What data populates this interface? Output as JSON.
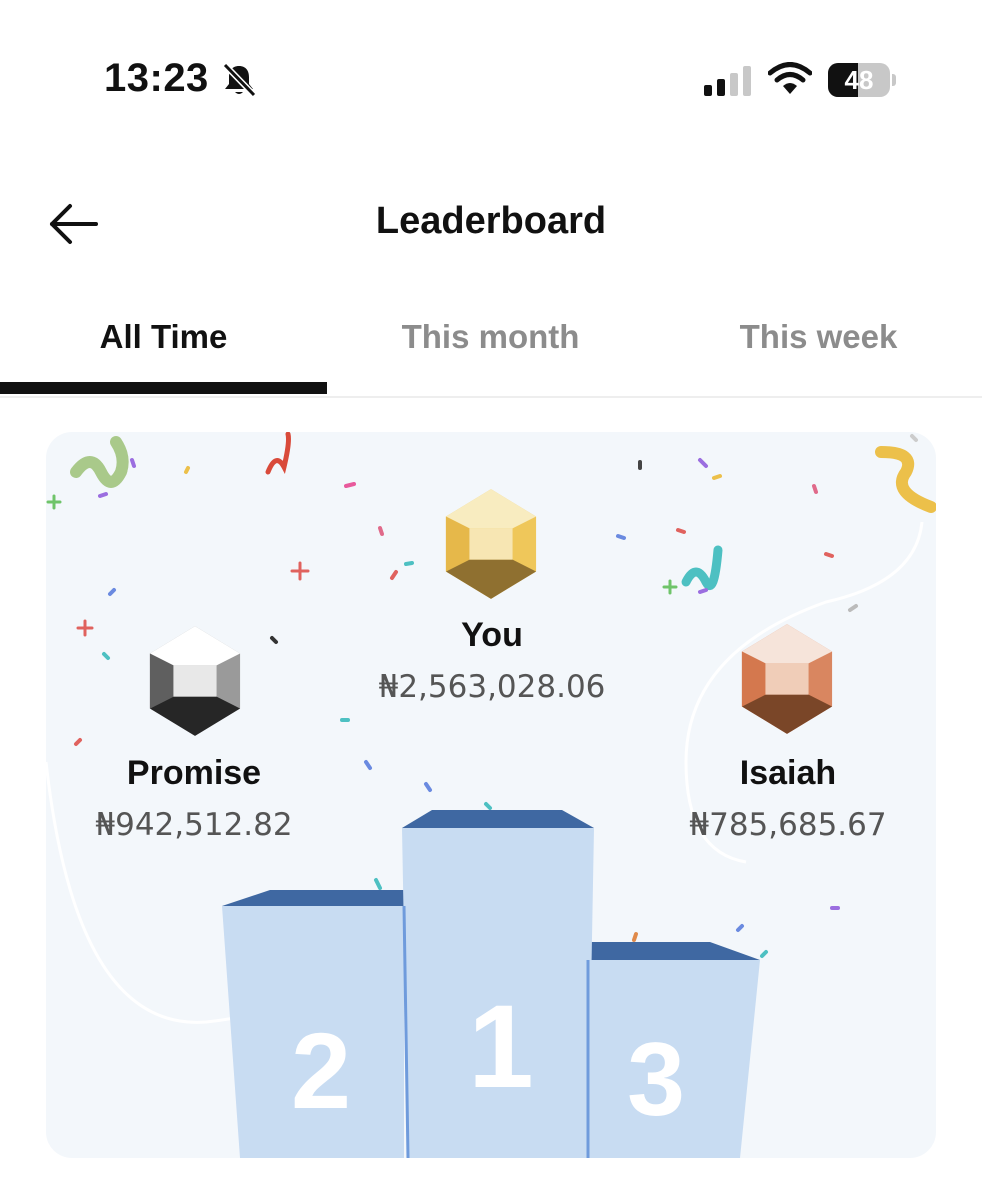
{
  "status_bar": {
    "time": "13:23",
    "battery_level": "48",
    "battery_fraction": 0.48,
    "icons": [
      "mute-icon",
      "signal-icon",
      "wifi-icon",
      "battery-icon"
    ]
  },
  "header": {
    "title": "Leaderboard",
    "back_icon": "arrow-left-icon"
  },
  "tabs": [
    {
      "label": "All Time",
      "active": true
    },
    {
      "label": "This month",
      "active": false
    },
    {
      "label": "This week",
      "active": false
    }
  ],
  "podium": {
    "first": {
      "rank": "1",
      "name": "You",
      "amount": "₦2,563,028.06",
      "gem": "gold-gem-icon"
    },
    "second": {
      "rank": "2",
      "name": "Promise",
      "amount": "₦942,512.82",
      "gem": "silver-gem-icon"
    },
    "third": {
      "rank": "3",
      "name": "Isaiah",
      "amount": "₦785,685.67",
      "gem": "bronze-gem-icon"
    }
  },
  "colors": {
    "card_background": "#f3f7fb",
    "podium_face": "#c8dcf2",
    "podium_top": "#3f68a2",
    "gold": "#efc75a",
    "silver": "#9a9a9a",
    "bronze": "#d98660"
  }
}
